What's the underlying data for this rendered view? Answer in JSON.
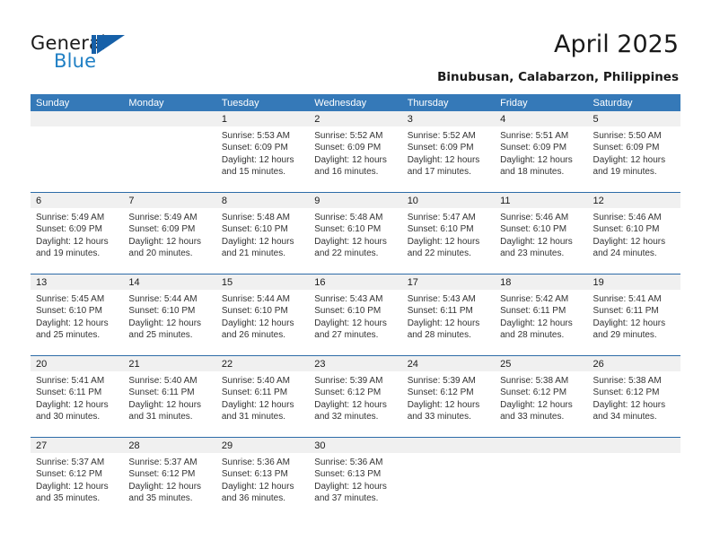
{
  "brand": {
    "name_part1": "General",
    "name_part2": "Blue",
    "logo_icon": "blue-triangle-logo",
    "accent_color": "#1f7fc4",
    "logo_dark_blue": "#1660a8"
  },
  "header": {
    "title": "April 2025",
    "subtitle": "Binubusan, Calabarzon, Philippines"
  },
  "calendar": {
    "header_bg_color": "#3579b8",
    "header_text_color": "#ffffff",
    "daynum_band_color": "#f0f0f0",
    "row_divider_color": "#2d6ca8",
    "weekdays": [
      "Sunday",
      "Monday",
      "Tuesday",
      "Wednesday",
      "Thursday",
      "Friday",
      "Saturday"
    ],
    "weeks": [
      [
        {
          "day": "",
          "sunrise": "",
          "sunset": "",
          "daylight_line1": "",
          "daylight_line2": ""
        },
        {
          "day": "",
          "sunrise": "",
          "sunset": "",
          "daylight_line1": "",
          "daylight_line2": ""
        },
        {
          "day": "1",
          "sunrise": "Sunrise: 5:53 AM",
          "sunset": "Sunset: 6:09 PM",
          "daylight_line1": "Daylight: 12 hours",
          "daylight_line2": "and 15 minutes."
        },
        {
          "day": "2",
          "sunrise": "Sunrise: 5:52 AM",
          "sunset": "Sunset: 6:09 PM",
          "daylight_line1": "Daylight: 12 hours",
          "daylight_line2": "and 16 minutes."
        },
        {
          "day": "3",
          "sunrise": "Sunrise: 5:52 AM",
          "sunset": "Sunset: 6:09 PM",
          "daylight_line1": "Daylight: 12 hours",
          "daylight_line2": "and 17 minutes."
        },
        {
          "day": "4",
          "sunrise": "Sunrise: 5:51 AM",
          "sunset": "Sunset: 6:09 PM",
          "daylight_line1": "Daylight: 12 hours",
          "daylight_line2": "and 18 minutes."
        },
        {
          "day": "5",
          "sunrise": "Sunrise: 5:50 AM",
          "sunset": "Sunset: 6:09 PM",
          "daylight_line1": "Daylight: 12 hours",
          "daylight_line2": "and 19 minutes."
        }
      ],
      [
        {
          "day": "6",
          "sunrise": "Sunrise: 5:49 AM",
          "sunset": "Sunset: 6:09 PM",
          "daylight_line1": "Daylight: 12 hours",
          "daylight_line2": "and 19 minutes."
        },
        {
          "day": "7",
          "sunrise": "Sunrise: 5:49 AM",
          "sunset": "Sunset: 6:09 PM",
          "daylight_line1": "Daylight: 12 hours",
          "daylight_line2": "and 20 minutes."
        },
        {
          "day": "8",
          "sunrise": "Sunrise: 5:48 AM",
          "sunset": "Sunset: 6:10 PM",
          "daylight_line1": "Daylight: 12 hours",
          "daylight_line2": "and 21 minutes."
        },
        {
          "day": "9",
          "sunrise": "Sunrise: 5:48 AM",
          "sunset": "Sunset: 6:10 PM",
          "daylight_line1": "Daylight: 12 hours",
          "daylight_line2": "and 22 minutes."
        },
        {
          "day": "10",
          "sunrise": "Sunrise: 5:47 AM",
          "sunset": "Sunset: 6:10 PM",
          "daylight_line1": "Daylight: 12 hours",
          "daylight_line2": "and 22 minutes."
        },
        {
          "day": "11",
          "sunrise": "Sunrise: 5:46 AM",
          "sunset": "Sunset: 6:10 PM",
          "daylight_line1": "Daylight: 12 hours",
          "daylight_line2": "and 23 minutes."
        },
        {
          "day": "12",
          "sunrise": "Sunrise: 5:46 AM",
          "sunset": "Sunset: 6:10 PM",
          "daylight_line1": "Daylight: 12 hours",
          "daylight_line2": "and 24 minutes."
        }
      ],
      [
        {
          "day": "13",
          "sunrise": "Sunrise: 5:45 AM",
          "sunset": "Sunset: 6:10 PM",
          "daylight_line1": "Daylight: 12 hours",
          "daylight_line2": "and 25 minutes."
        },
        {
          "day": "14",
          "sunrise": "Sunrise: 5:44 AM",
          "sunset": "Sunset: 6:10 PM",
          "daylight_line1": "Daylight: 12 hours",
          "daylight_line2": "and 25 minutes."
        },
        {
          "day": "15",
          "sunrise": "Sunrise: 5:44 AM",
          "sunset": "Sunset: 6:10 PM",
          "daylight_line1": "Daylight: 12 hours",
          "daylight_line2": "and 26 minutes."
        },
        {
          "day": "16",
          "sunrise": "Sunrise: 5:43 AM",
          "sunset": "Sunset: 6:10 PM",
          "daylight_line1": "Daylight: 12 hours",
          "daylight_line2": "and 27 minutes."
        },
        {
          "day": "17",
          "sunrise": "Sunrise: 5:43 AM",
          "sunset": "Sunset: 6:11 PM",
          "daylight_line1": "Daylight: 12 hours",
          "daylight_line2": "and 28 minutes."
        },
        {
          "day": "18",
          "sunrise": "Sunrise: 5:42 AM",
          "sunset": "Sunset: 6:11 PM",
          "daylight_line1": "Daylight: 12 hours",
          "daylight_line2": "and 28 minutes."
        },
        {
          "day": "19",
          "sunrise": "Sunrise: 5:41 AM",
          "sunset": "Sunset: 6:11 PM",
          "daylight_line1": "Daylight: 12 hours",
          "daylight_line2": "and 29 minutes."
        }
      ],
      [
        {
          "day": "20",
          "sunrise": "Sunrise: 5:41 AM",
          "sunset": "Sunset: 6:11 PM",
          "daylight_line1": "Daylight: 12 hours",
          "daylight_line2": "and 30 minutes."
        },
        {
          "day": "21",
          "sunrise": "Sunrise: 5:40 AM",
          "sunset": "Sunset: 6:11 PM",
          "daylight_line1": "Daylight: 12 hours",
          "daylight_line2": "and 31 minutes."
        },
        {
          "day": "22",
          "sunrise": "Sunrise: 5:40 AM",
          "sunset": "Sunset: 6:11 PM",
          "daylight_line1": "Daylight: 12 hours",
          "daylight_line2": "and 31 minutes."
        },
        {
          "day": "23",
          "sunrise": "Sunrise: 5:39 AM",
          "sunset": "Sunset: 6:12 PM",
          "daylight_line1": "Daylight: 12 hours",
          "daylight_line2": "and 32 minutes."
        },
        {
          "day": "24",
          "sunrise": "Sunrise: 5:39 AM",
          "sunset": "Sunset: 6:12 PM",
          "daylight_line1": "Daylight: 12 hours",
          "daylight_line2": "and 33 minutes."
        },
        {
          "day": "25",
          "sunrise": "Sunrise: 5:38 AM",
          "sunset": "Sunset: 6:12 PM",
          "daylight_line1": "Daylight: 12 hours",
          "daylight_line2": "and 33 minutes."
        },
        {
          "day": "26",
          "sunrise": "Sunrise: 5:38 AM",
          "sunset": "Sunset: 6:12 PM",
          "daylight_line1": "Daylight: 12 hours",
          "daylight_line2": "and 34 minutes."
        }
      ],
      [
        {
          "day": "27",
          "sunrise": "Sunrise: 5:37 AM",
          "sunset": "Sunset: 6:12 PM",
          "daylight_line1": "Daylight: 12 hours",
          "daylight_line2": "and 35 minutes."
        },
        {
          "day": "28",
          "sunrise": "Sunrise: 5:37 AM",
          "sunset": "Sunset: 6:12 PM",
          "daylight_line1": "Daylight: 12 hours",
          "daylight_line2": "and 35 minutes."
        },
        {
          "day": "29",
          "sunrise": "Sunrise: 5:36 AM",
          "sunset": "Sunset: 6:13 PM",
          "daylight_line1": "Daylight: 12 hours",
          "daylight_line2": "and 36 minutes."
        },
        {
          "day": "30",
          "sunrise": "Sunrise: 5:36 AM",
          "sunset": "Sunset: 6:13 PM",
          "daylight_line1": "Daylight: 12 hours",
          "daylight_line2": "and 37 minutes."
        },
        {
          "day": "",
          "sunrise": "",
          "sunset": "",
          "daylight_line1": "",
          "daylight_line2": ""
        },
        {
          "day": "",
          "sunrise": "",
          "sunset": "",
          "daylight_line1": "",
          "daylight_line2": ""
        },
        {
          "day": "",
          "sunrise": "",
          "sunset": "",
          "daylight_line1": "",
          "daylight_line2": ""
        }
      ]
    ]
  }
}
